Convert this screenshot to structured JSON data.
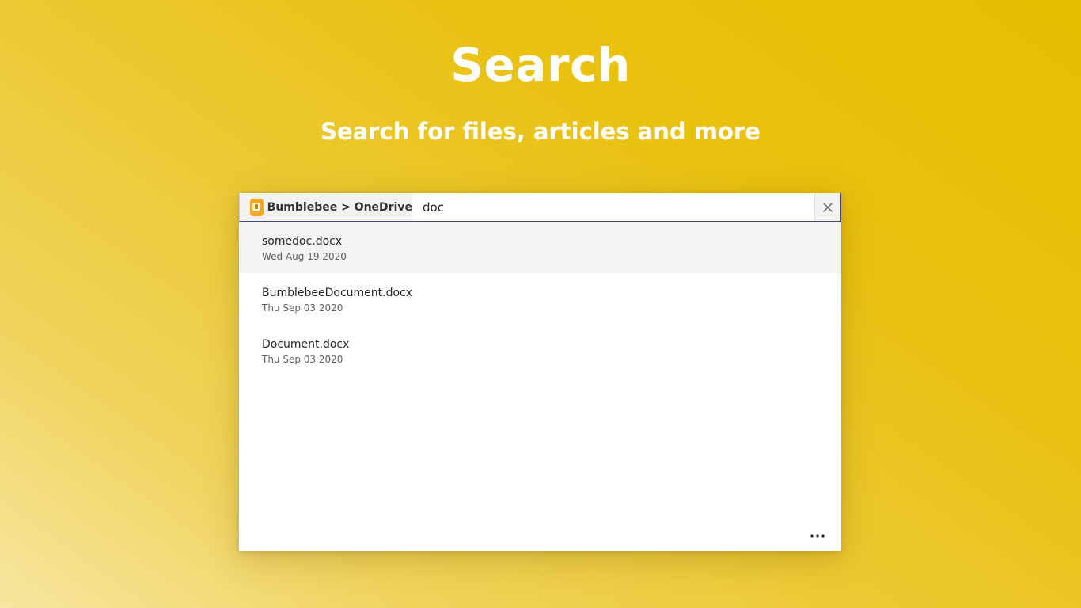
{
  "hero": {
    "title": "Search",
    "subtitle": "Search for files, articles and more"
  },
  "search": {
    "scope_label": "Bumblebee > OneDrive",
    "query": "doc",
    "clear_icon": "close-icon"
  },
  "results": [
    {
      "name": "somedoc.docx",
      "date": "Wed Aug 19 2020",
      "selected": true
    },
    {
      "name": "BumblebeeDocument.docx",
      "date": "Thu Sep 03 2020",
      "selected": false
    },
    {
      "name": "Document.docx",
      "date": "Thu Sep 03 2020",
      "selected": false
    }
  ],
  "footer": {
    "more_icon": "more-horizontal-icon"
  },
  "colors": {
    "background_start": "#f7e6a0",
    "background_end": "#e8be00",
    "app_icon": "#f5a623",
    "selected_row": "#f3f3f3",
    "accent_border": "#464775"
  }
}
